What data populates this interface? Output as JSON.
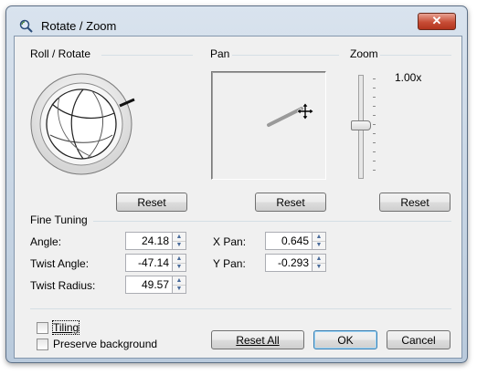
{
  "window": {
    "title": "Rotate / Zoom",
    "close_label": "✕"
  },
  "roll": {
    "label": "Roll / Rotate",
    "reset_label": "Reset"
  },
  "pan": {
    "label": "Pan",
    "reset_label": "Reset"
  },
  "zoom": {
    "label": "Zoom",
    "value": "1.00x",
    "reset_label": "Reset",
    "level_fraction": 0.5
  },
  "fine_tuning": {
    "label": "Fine Tuning",
    "angle": {
      "label": "Angle:",
      "value": "24.18"
    },
    "twist_angle": {
      "label": "Twist Angle:",
      "value": "-47.14"
    },
    "twist_radius": {
      "label": "Twist Radius:",
      "value": "49.57"
    },
    "x_pan": {
      "label": "X Pan:",
      "value": "0.645"
    },
    "y_pan": {
      "label": "Y Pan:",
      "value": "-0.293"
    }
  },
  "options": {
    "tiling": {
      "label": "Tiling",
      "checked": false
    },
    "preserve_background": {
      "label": "Preserve background",
      "checked": false
    }
  },
  "buttons": {
    "reset_all": "Reset All",
    "ok": "OK",
    "cancel": "Cancel"
  },
  "icons": {
    "title": "rotate-zoom-icon",
    "pan_cursor": "move-cursor-icon",
    "spin_up": "▲",
    "spin_down": "▼"
  }
}
